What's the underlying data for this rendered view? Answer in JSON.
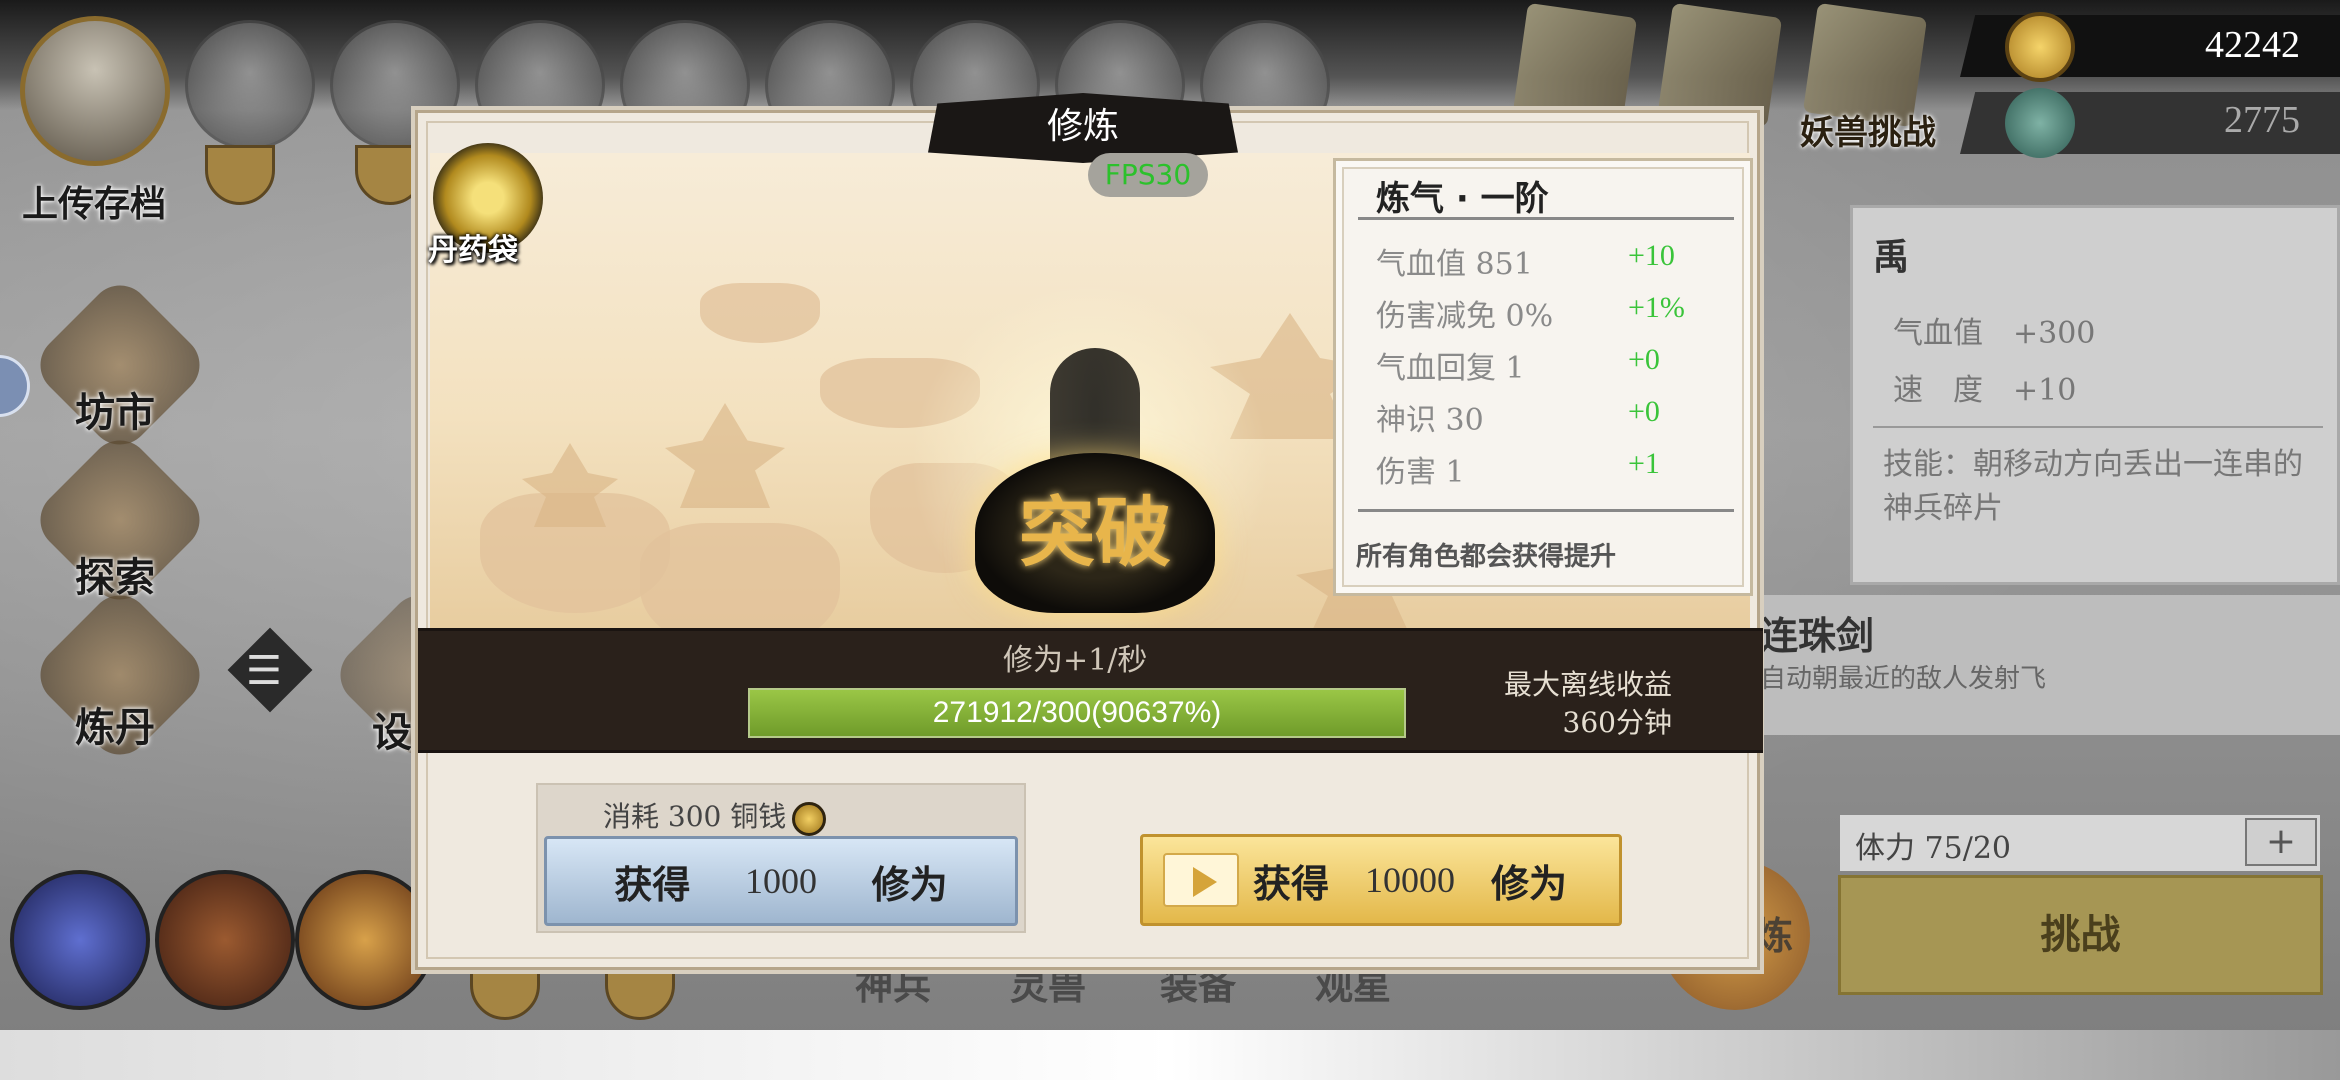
{
  "hud": {
    "save_label": "上传存档",
    "coins": "42242",
    "jade": "2775",
    "challenge_tag": "妖兽挑战",
    "side_menu": [
      "坊市",
      "探索",
      "炼丹"
    ],
    "side_partial": "设",
    "bottom_tabs": [
      "神兵",
      "灵兽",
      "装备",
      "观星"
    ],
    "bottom_partial": "炼"
  },
  "right_panel": {
    "name": "禹",
    "stat1": "气血值　+300",
    "stat2": "速　度　+10",
    "skill": "技能：朝移动方向丢出一连串的神兵碎片"
  },
  "right_panel2": {
    "title": "连珠剑",
    "desc": "自动朝最近的敌人发射飞"
  },
  "stamina": {
    "label": "体力 75/20",
    "plus": "+",
    "challenge": "挑战"
  },
  "modal": {
    "title": "修炼",
    "fps": "FPS30",
    "pill_label": "丹药袋",
    "breakthrough": "突破",
    "stats": {
      "title": "炼气 · 一阶",
      "rows": [
        {
          "name": "气血值 851",
          "delta": "+10"
        },
        {
          "name": "伤害减免 0%",
          "delta": "+1%"
        },
        {
          "name": "气血回复 1",
          "delta": "+0"
        },
        {
          "name": "神识 30",
          "delta": "+0"
        },
        {
          "name": "伤害 1",
          "delta": "+1"
        }
      ],
      "note": "所有角色都会获得提升"
    },
    "rate": "修为+1/秒",
    "progress": {
      "text": "271912/300(90637%)",
      "fill_fraction": 1.0
    },
    "offline_label": "最大离线收益",
    "offline_value": "360分钟",
    "cost_label": "消耗 300 铜钱",
    "btn_normal": {
      "word1": "获得",
      "amount": "1000",
      "word2": "修为"
    },
    "btn_ad": {
      "word1": "获得",
      "amount": "10000",
      "word2": "修为"
    }
  },
  "colors": {
    "accent_green": "#3ac43a",
    "progress_green": "#8ab83a",
    "gold_button": "#e3b84a",
    "blue_button": "#a9bfd6"
  }
}
